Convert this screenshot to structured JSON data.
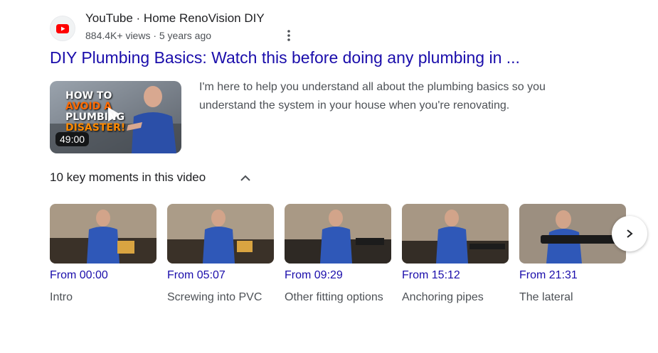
{
  "result": {
    "source": "YouTube · Home RenoVision DIY",
    "meta": "884.4K+ views · 5 years ago",
    "title": "DIY Plumbing Basics: Watch this before doing any plumbing in ...",
    "snippet": "I'm here to help you understand all about the plumbing basics so you understand the system in your house when you're renovating.",
    "thumbnail": {
      "overlay_text": [
        "HOW TO",
        "AVOID A",
        "PLUMBING",
        "DISASTER!"
      ],
      "duration": "49:00"
    }
  },
  "key_moments": {
    "header": "10 key moments in this video",
    "items": [
      {
        "time": "From 00:00",
        "label": "Intro"
      },
      {
        "time": "From 05:07",
        "label": "Screwing into PVC"
      },
      {
        "time": "From 09:29",
        "label": "Other fitting options"
      },
      {
        "time": "From 15:12",
        "label": "Anchoring pipes"
      },
      {
        "time": "From 21:31",
        "label": "The lateral"
      }
    ]
  },
  "icons": {
    "favicon": "youtube-icon",
    "menu": "more-vert-icon",
    "collapse": "chevron-up-icon",
    "next": "chevron-right-icon",
    "play": "play-icon"
  },
  "colors": {
    "link": "#1a0dab",
    "youtube_red": "#ff0000"
  }
}
